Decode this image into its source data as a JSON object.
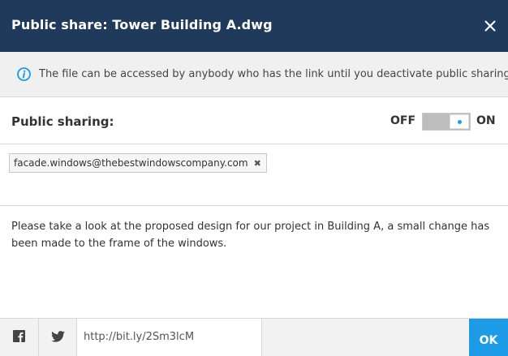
{
  "dialog": {
    "title": "Public share: Tower Building A.dwg",
    "close_icon": "close-icon"
  },
  "info": {
    "icon": "info-icon",
    "text": "The file can be accessed by anybody who has the link until you deactivate public sharing"
  },
  "sharing": {
    "label": "Public sharing:",
    "off_label": "OFF",
    "on_label": "ON",
    "enabled": true
  },
  "recipients": [
    {
      "email": "facade.windows@thebestwindowscompany.com",
      "remove_label": "✖"
    }
  ],
  "message": {
    "text": "Please take a look at the proposed design for our project in Building A, a small change has been made to the frame of the windows."
  },
  "footer": {
    "facebook_icon": "facebook-icon",
    "twitter_icon": "twitter-icon",
    "link": "http://bit.ly/2Sm3lcM",
    "ok_label": "OK"
  },
  "colors": {
    "titlebar": "#1f3a5b",
    "accent": "#1e9be6",
    "info_bg": "#f0f0f0"
  }
}
